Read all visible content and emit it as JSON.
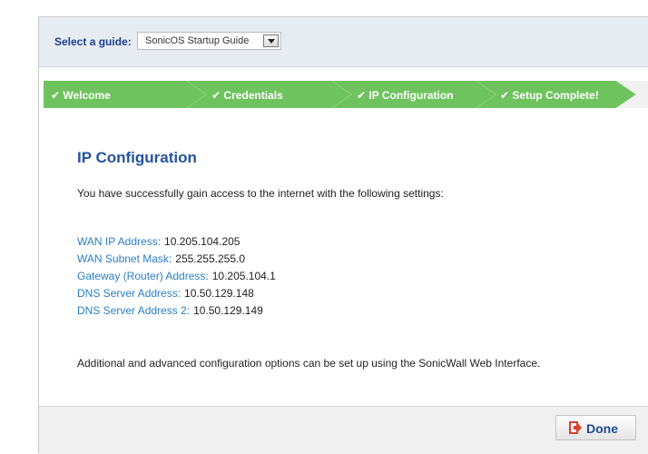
{
  "guide_bar": {
    "label": "Select a guide:",
    "selected_guide": "SonicOS Startup Guide"
  },
  "steps": [
    {
      "label": "✔ Welcome",
      "state": "completed"
    },
    {
      "label": "✔ Credentials",
      "state": "completed"
    },
    {
      "label": "✔ IP Configuration",
      "state": "completed"
    },
    {
      "label": "✔ Setup Complete!",
      "state": "completed"
    }
  ],
  "main": {
    "title": "IP Configuration",
    "intro": "You have successfully gain access to the internet with the following settings:",
    "settings": [
      {
        "label": "WAN IP Address:",
        "value": "10.205.104.205"
      },
      {
        "label": "WAN Subnet Mask:",
        "value": "255.255.255.0"
      },
      {
        "label": "Gateway (Router) Address:",
        "value": "10.205.104.1"
      },
      {
        "label": "DNS Server Address:",
        "value": "10.50.129.148"
      },
      {
        "label": "DNS Server Address 2:",
        "value": "10.50.129.149"
      }
    ],
    "footer_note": "Additional and advanced configuration options can be set up using the SonicWall Web Interface."
  },
  "buttons": {
    "done_label": "Done",
    "done_icon": "exit-icon"
  },
  "colors": {
    "step_green": "#6fc35e",
    "title_blue": "#2453a0",
    "link_blue": "#2a7fc4",
    "exit_red": "#d9412b"
  }
}
